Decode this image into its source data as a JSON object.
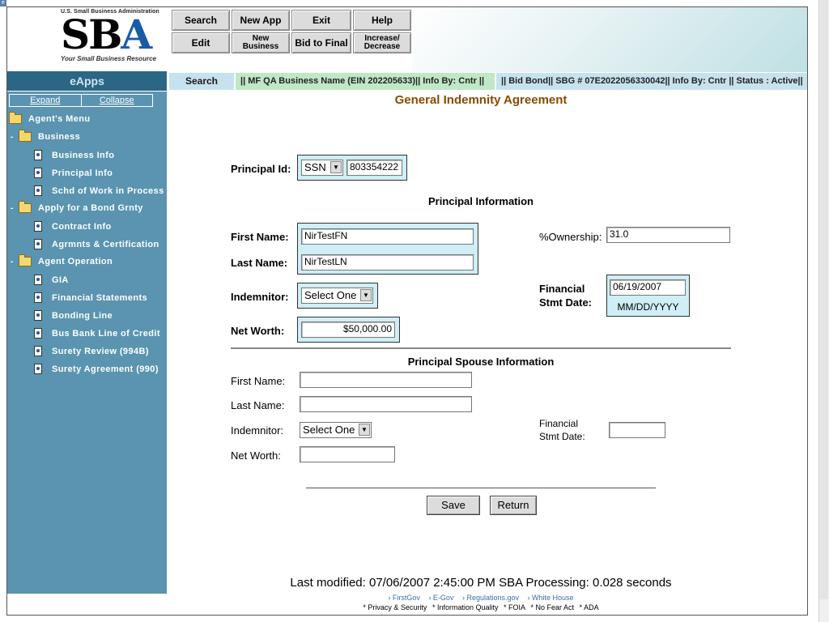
{
  "header": {
    "agency_line": "U.S. Small Business Administration",
    "logo_text_a": "SB",
    "logo_text_b": "A",
    "tagline": "Your Small Business Resource",
    "buttons": {
      "search": "Search",
      "new_app": "New App",
      "exit": "Exit",
      "help": "Help",
      "edit": "Edit",
      "new_business_1": "New",
      "new_business_2": "Business",
      "bid_to_final": "Bid to Final",
      "increase_1": "Increase/",
      "increase_2": "Decrease"
    }
  },
  "tabs": {
    "app_name": "eApps",
    "search": "Search",
    "business": "|| MF QA Business Name (EIN 202205633)|| Info By:  Cntr  ||",
    "bond": "|| Bid Bond|| SBG # 07E2022056330042|| Info By:  Cntr || Status : Active||"
  },
  "sidebar": {
    "expand": "Expand",
    "collapse": "Collapse",
    "agents_menu": "Agent's Menu",
    "folders": {
      "business": "Business",
      "apply": "Apply for a Bond Grnty",
      "agent_operation": "Agent Operation"
    },
    "business_items": [
      "Business Info",
      "Principal Info",
      "Schd of Work in Process"
    ],
    "apply_items": [
      "Contract Info",
      "Agrmnts & Certification"
    ],
    "agent_items": [
      "GIA",
      "Financial Statements",
      "Bonding Line",
      "Bus Bank Line of Credit",
      "Surety Review (994B)",
      "Surety Agreement (990)"
    ]
  },
  "form": {
    "title": "General Indemnity Agreement",
    "principal_id_label": "Principal Id:",
    "principal_id_type": "SSN",
    "principal_id_value": "803354222",
    "principal_section": "Principal Information",
    "first_name_label": "First Name:",
    "first_name_value": "NirTestFN",
    "last_name_label": "Last Name:",
    "last_name_value": "NirTestLN",
    "ownership_label": "%Ownership:",
    "ownership_value": "31.0",
    "indemnitor_label": "Indemnitor:",
    "indemnitor_value": "Select One",
    "fin_stmt_label_1": "Financial",
    "fin_stmt_label_2": "Stmt Date:",
    "fin_stmt_value": "06/19/2007",
    "date_format_hint": "MM/DD/YYYY",
    "net_worth_label": "Net Worth:",
    "net_worth_value": "$50,000.00",
    "spouse_section": "Principal Spouse Information",
    "spouse_first_name_label": "First Name:",
    "spouse_first_name_value": "",
    "spouse_last_name_label": "Last Name:",
    "spouse_last_name_value": "",
    "spouse_indemnitor_label": "Indemnitor:",
    "spouse_indemnitor_value": "Select One",
    "spouse_fin_stmt_label_1": "Financial",
    "spouse_fin_stmt_label_2": "Stmt Date:",
    "spouse_fin_stmt_value": "",
    "spouse_net_worth_label": "Net Worth:",
    "spouse_net_worth_value": "",
    "save_label": "Save",
    "return_label": "Return"
  },
  "footer": {
    "last_modified": "Last modified: 07/06/2007 2:45:00 PM   SBA Processing:  0.028 seconds",
    "links": [
      "› FirstGov",
      "› E-Gov",
      "› Regulations.gov",
      "› White House"
    ],
    "policies": [
      "* Privacy & Security",
      "* Information Quality",
      "* FOIA",
      "* No Fear Act",
      "* ADA"
    ]
  }
}
